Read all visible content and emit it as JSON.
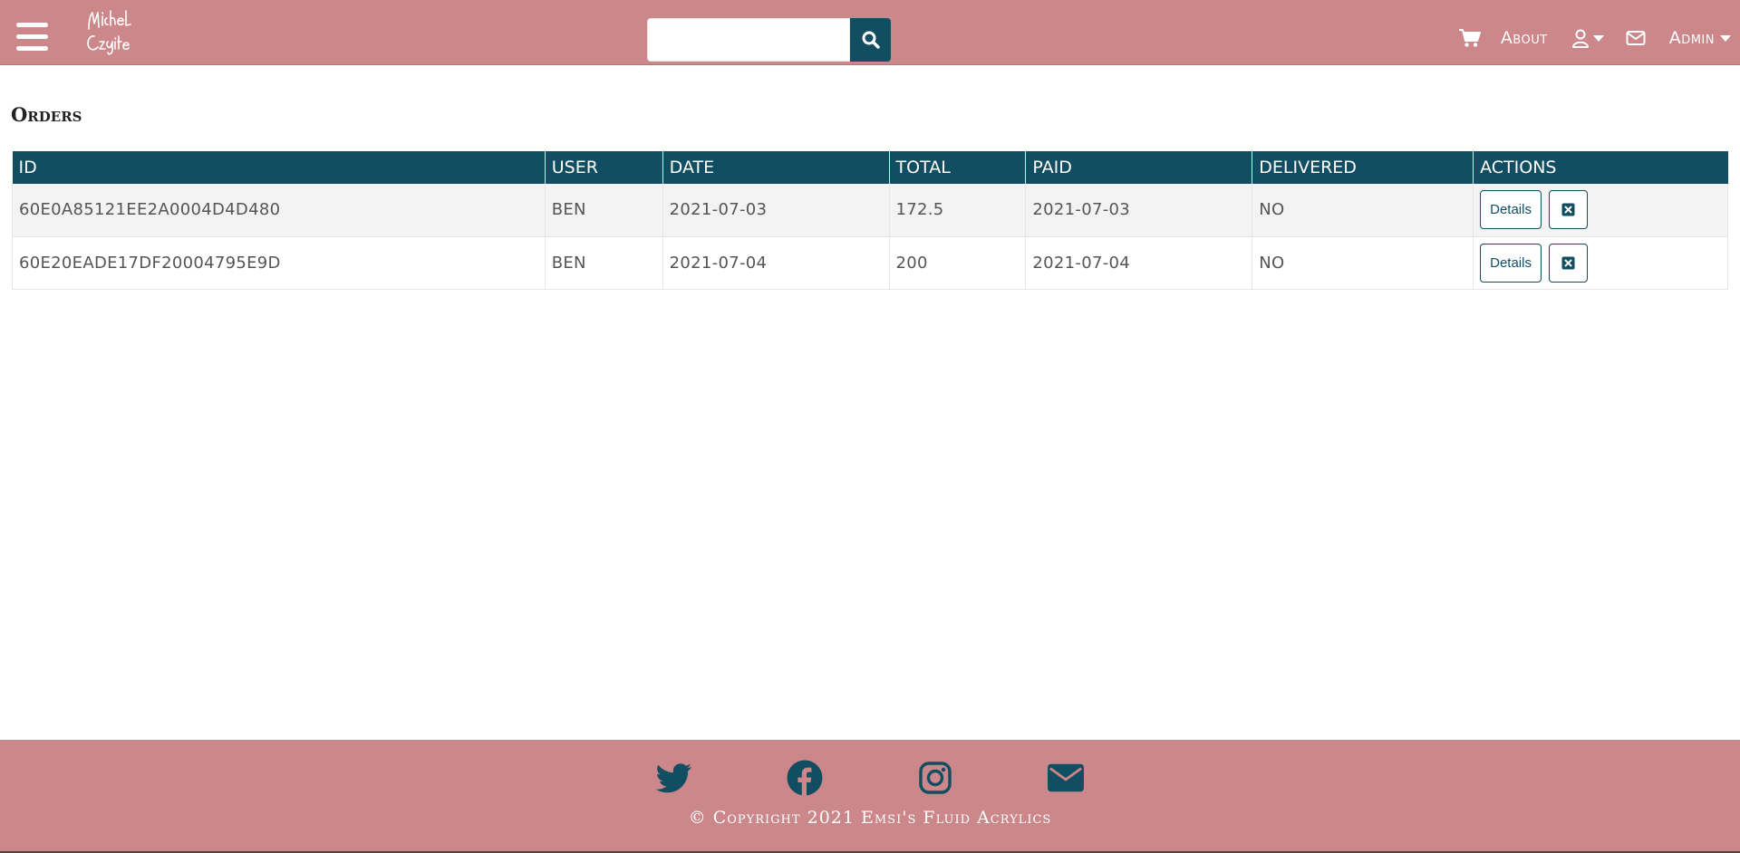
{
  "header": {
    "logo_text": "Michel Czaylea",
    "search": {
      "value": "",
      "placeholder": ""
    },
    "nav": {
      "about_label": "About",
      "admin_label": "Admin"
    },
    "icons": {
      "menu": "hamburger-menu-icon",
      "search": "search-icon",
      "cart": "shopping-cart-icon",
      "user": "user-icon",
      "mail": "envelope-icon"
    }
  },
  "main": {
    "title": "Orders",
    "table": {
      "columns": [
        "ID",
        "USER",
        "DATE",
        "TOTAL",
        "PAID",
        "DELIVERED",
        "ACTIONS"
      ],
      "rows": [
        {
          "id": "60E0A85121EE2A0004D4D480",
          "user": "BEN",
          "date": "2021-07-03",
          "total": "172.5",
          "paid": "2021-07-03",
          "delivered": "NO",
          "details_label": "Details"
        },
        {
          "id": "60E20EADE17DF20004795E9D",
          "user": "BEN",
          "date": "2021-07-04",
          "total": "200",
          "paid": "2021-07-04",
          "delivered": "NO",
          "details_label": "Details"
        }
      ]
    }
  },
  "footer": {
    "socials": [
      "twitter-icon",
      "facebook-icon",
      "instagram-icon",
      "envelope-icon"
    ],
    "copyright": "© Copyright 2021 Emsi's Fluid Acrylics"
  },
  "colors": {
    "brand_pink": "#cb8789",
    "brand_teal": "#124e62"
  }
}
